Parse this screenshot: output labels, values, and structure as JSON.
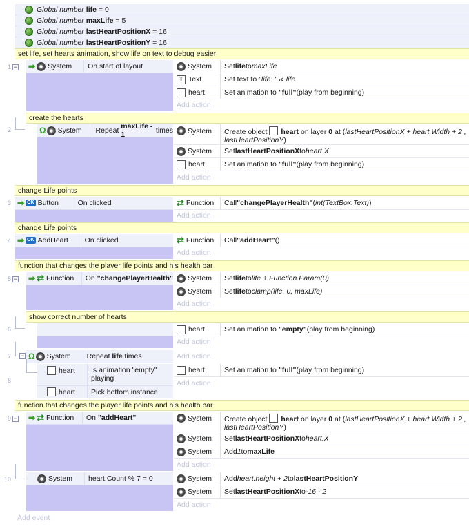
{
  "globals": [
    {
      "prefix": "Global number",
      "name": "life",
      "value": "= 0"
    },
    {
      "prefix": "Global number",
      "name": "maxLife",
      "value": "= 5"
    },
    {
      "prefix": "Global number",
      "name": "lastHeartPositionX",
      "value": "= 16"
    },
    {
      "prefix": "Global number",
      "name": "lastHeartPositionY",
      "value": "= 16"
    }
  ],
  "comments": {
    "c1": "set life, set hearts animation, show life on text to debug easier",
    "c2": "create the hearts",
    "c3": "change Life points",
    "c4": "change Life points",
    "c5": "function that changes the player life points and his health bar",
    "c6": "show correct number of hearts",
    "c7": "function that changes the player life points and his health bar"
  },
  "line_numbers": [
    "1",
    "2",
    "3",
    "4",
    "5",
    "6",
    "7",
    "8",
    "9",
    "10"
  ],
  "ev1": {
    "obj": "System",
    "cond": "On start of layout",
    "a1_obj": "System",
    "a1_pre": "Set ",
    "a1_b": "life",
    "a1_mid": " to ",
    "a1_i": "maxLife",
    "a2_obj": "Text",
    "a2_pre": "Set text to ",
    "a2_i": "\"life: \" & life",
    "a3_obj": "heart",
    "a3_pre": "Set animation to ",
    "a3_b": "\"full\"",
    "a3_post": " (play from beginning)"
  },
  "ev2": {
    "obj": "System",
    "cond_pre": "Repeat ",
    "cond_b": "maxLife - 1",
    "cond_post": " times",
    "a1_obj": "System",
    "a1_pre": "Create object ",
    "a1_b1": "heart",
    "a1_mid": " on layer ",
    "a1_b2": "0",
    "a1_mid2": " at (",
    "a1_i": "lastHeartPositionX + heart.Width + 2 ,",
    "a1_i2": "lastHeartPositionY",
    "a1_close": ")",
    "a2_obj": "System",
    "a2_pre": "Set ",
    "a2_b": "lastHeartPositionX",
    "a2_mid": " to ",
    "a2_i": "heart.X",
    "a3_obj": "heart",
    "a3_pre": "Set animation to ",
    "a3_b": "\"full\"",
    "a3_post": " (play from beginning)"
  },
  "ev3": {
    "obj": "Button",
    "cond": "On clicked",
    "a1_obj": "Function",
    "a1_pre": "Call ",
    "a1_b": "\"changePlayerHealth\"",
    "a1_mid": " (",
    "a1_i": "int(TextBox.Text)",
    "a1_post": " )"
  },
  "ev4": {
    "obj": "AddHeart",
    "cond": "On clicked",
    "a1_obj": "Function",
    "a1_pre": "Call ",
    "a1_b": "\"addHeart\"",
    "a1_post": " ()"
  },
  "ev5": {
    "obj": "Function",
    "cond_pre": "On ",
    "cond_b": "\"changePlayerHealth\"",
    "a1_obj": "System",
    "a1_pre": "Set ",
    "a1_b": "life",
    "a1_mid": " to ",
    "a1_i": "life + Function.Param(0)",
    "a2_obj": "System",
    "a2_pre": "Set ",
    "a2_b": "life",
    "a2_mid": " to ",
    "a2_i": "clamp(life, 0, maxLife)"
  },
  "ev6": {
    "a1_obj": "heart",
    "a1_pre": "Set animation to ",
    "a1_b": "\"empty\"",
    "a1_post": " (play from beginning)"
  },
  "ev7": {
    "obj": "System",
    "cond_pre": "Repeat ",
    "cond_b": "life",
    "cond_post": " times"
  },
  "ev8": {
    "c1_obj": "heart",
    "c1_text": "Is animation \"empty\" playing",
    "c2_obj": "heart",
    "c2_text": "Pick bottom instance",
    "a1_obj": "heart",
    "a1_pre": "Set animation to ",
    "a1_b": "\"full\"",
    "a1_post": " (play from beginning)"
  },
  "ev9": {
    "obj": "Function",
    "cond_pre": "On ",
    "cond_b": "\"addHeart\"",
    "a1_obj": "System",
    "a1_pre": "Create object ",
    "a1_b1": "heart",
    "a1_mid": " on layer ",
    "a1_b2": "0",
    "a1_mid2": " at (",
    "a1_i": "lastHeartPositionX + heart.Width + 2 ,",
    "a1_i2": "lastHeartPositionY",
    "a1_close": ")",
    "a2_obj": "System",
    "a2_pre": "Set ",
    "a2_b": "lastHeartPositionX",
    "a2_mid": " to ",
    "a2_i": "heart.X",
    "a3_obj": "System",
    "a3_pre": "Add ",
    "a3_i": "1",
    "a3_mid": " to ",
    "a3_b": "maxLife"
  },
  "ev10": {
    "obj": "System",
    "cond": "heart.Count % 7 = 0",
    "a1_obj": "System",
    "a1_pre": "Add ",
    "a1_i": "heart.height + 2",
    "a1_mid": "  to ",
    "a1_b": "lastHeartPositionY",
    "a2_obj": "System",
    "a2_pre": "Set ",
    "a2_b": "lastHeartPositionX",
    "a2_mid": " to ",
    "a2_i": "-16 - 2"
  },
  "add_action": "Add action",
  "add_event": "Add event"
}
